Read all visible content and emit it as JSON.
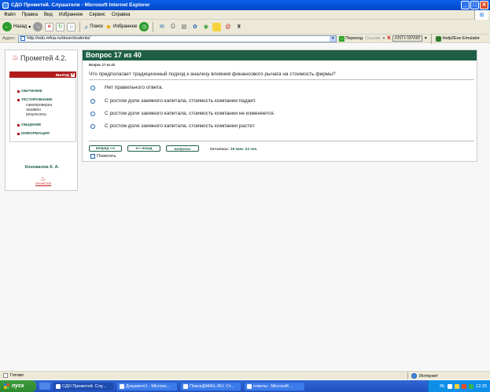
{
  "window": {
    "title": "СДО Прометей. Слушатели - Microsoft Internet Explorer"
  },
  "menubar": {
    "items": [
      "Файл",
      "Правка",
      "Вид",
      "Избранное",
      "Сервис",
      "Справка"
    ]
  },
  "toolbar": {
    "back_label": "Назад",
    "search_label": "Поиск",
    "favorites_label": "Избранное"
  },
  "addressbar": {
    "label": "Адрес:",
    "url": "http://edu.mfua.ru/dose/students/",
    "go_label": "Переход",
    "links_label": "Ссылки",
    "kaspersky_label": "K",
    "kaspersky_box": "ANTI-SPAM",
    "emulator_label": "Help2Exe Emulator"
  },
  "sidebar": {
    "logo_text": "Прометей 4.2.",
    "exit_label": "ВЫХОД",
    "nav": [
      {
        "label": "ОБУЧЕНИЕ"
      },
      {
        "label": "ТЕСТИРОВАНИЕ"
      },
      {
        "label": "ОБЩЕНИЕ"
      },
      {
        "label": "ИНФОРМАЦИЯ"
      }
    ],
    "testing_sub": [
      "самопроверка",
      "экзамен",
      "результаты"
    ],
    "user_name": "Коновалов К. А.",
    "small_logo_text": "ПРОМЕТЕЙ"
  },
  "test": {
    "header": "Вопрос 17 из 40",
    "small_header": "Вопрос 17 из 40",
    "question": "Что предполагает традиционный подход к анализу влияния финансового рычага на стоимость фирмы?",
    "options": [
      "Нет правильного ответа.",
      "С ростом доли заемного капитала, стоимость компании падает.",
      "С ростом доли заемного капитала, стоимость компании не изменяется.",
      "С ростом доли заемного капитала, стоимость компании растет."
    ],
    "forward_label": "вперед ⟶",
    "back_label": "⟵ назад",
    "questions_label": "вопросы",
    "time_prefix": "Осталось:",
    "time_value": "19 мин. 23 сек.",
    "mark_label": "Пометить"
  },
  "statusbar": {
    "status_text": "Готово",
    "zone_text": "Интернет"
  },
  "taskbar": {
    "start_label": "пуск",
    "tasks": [
      "СДО Прометей. Слу...",
      "Документ1 - Microso...",
      "Поиск@MAIL.RU: Ст...",
      "ответы - Microsoft ..."
    ],
    "tray_lang": "RL",
    "clock": "12:25"
  },
  "colors": {
    "header_green": "#1e5f45",
    "exit_red": "#b01c1c",
    "xp_blue": "#0146c8"
  }
}
